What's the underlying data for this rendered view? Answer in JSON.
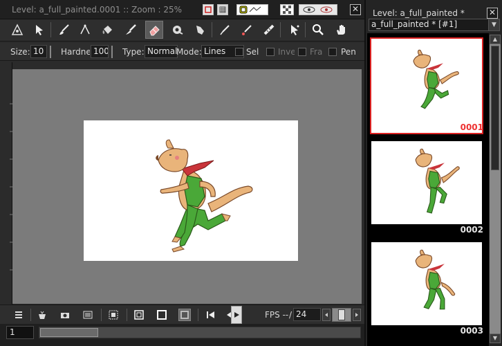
{
  "viewer": {
    "title": "Level: a_full_painted.0001  ::  Zoom : 25%",
    "close_glyph": "✕"
  },
  "tools": [
    "animate-icon",
    "selection-icon",
    "brush-icon",
    "geometric-icon",
    "fill-icon",
    "paint-brush-icon",
    "eraser-icon",
    "tape-icon",
    "finger-icon",
    "style-picker-icon",
    "rgb-picker-icon",
    "ruler-icon",
    "control-point-editor-icon",
    "zoom-icon",
    "hand-icon"
  ],
  "options": {
    "size_label": "Size:",
    "size_value": "10",
    "hardness_label": "Hardne",
    "hardness_value": "100",
    "type_label": "Type:",
    "type_value": "Normal",
    "mode_label": "Mode:",
    "mode_value": "Lines",
    "selective_label": "Sel",
    "invert_label": "Inve",
    "frame_label": "Fra",
    "pencil_label": "Pen"
  },
  "playback": {
    "fps_label": "FPS --",
    "fps_separator": "/",
    "fps_value": "24"
  },
  "frame": {
    "value": "1"
  },
  "strip": {
    "title": "Level:  a_full_painted *",
    "select_value": "a_full_painted *  [#1]",
    "thumbs": [
      {
        "number": "0001",
        "current": true
      },
      {
        "number": "0002",
        "current": false
      },
      {
        "number": "0003",
        "current": false
      }
    ]
  },
  "colors": {
    "accent_red": "#d22222",
    "canvas_gray": "#7b7b7b"
  }
}
